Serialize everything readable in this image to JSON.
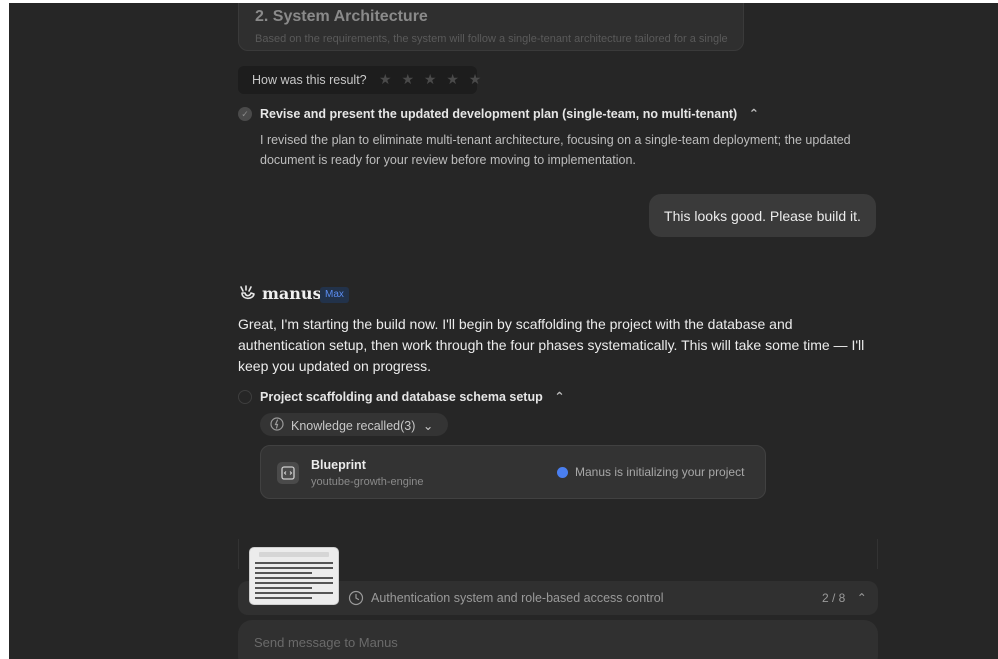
{
  "previous_card": {
    "title": "2. System Architecture",
    "excerpt": "Based on the requirements, the system will follow a single-tenant architecture tailored for a single"
  },
  "rating": {
    "prompt": "How was this result?",
    "stars": "★ ★ ★ ★ ★"
  },
  "completed_step": {
    "title": "Revise and present the updated development plan (single-team, no multi-tenant)",
    "chevron": "⌃",
    "body": "I revised the plan to eliminate multi-tenant architecture, focusing on a single-team deployment; the updated document is ready for your review before moving to implementation."
  },
  "user_message": {
    "text": "This looks good. Please build it."
  },
  "assistant": {
    "name": "manus",
    "badge": "Max",
    "message": "Great, I'm starting the build now. I'll begin by scaffolding the project with the database and authentication setup, then work through the four phases systematically. This will take some time — I'll keep you updated on progress."
  },
  "current_step": {
    "title": "Project scaffolding and database schema setup",
    "chevron": "⌃"
  },
  "knowledge": {
    "label": "Knowledge recalled(3)",
    "chevron": "⌄"
  },
  "blueprint": {
    "title": "Blueprint",
    "subtitle": "youtube-growth-engine",
    "status": "Manus is initializing your project",
    "status_color": "#4a7ff0"
  },
  "task_bar": {
    "label": "Authentication system and role-based access control",
    "count": "2 / 8",
    "chevron": "⌃"
  },
  "composer": {
    "placeholder": "Send message to Manus"
  },
  "colors": {
    "background": "#262626",
    "accent": "#4a7ff0",
    "badge_text": "#5b8df2"
  }
}
